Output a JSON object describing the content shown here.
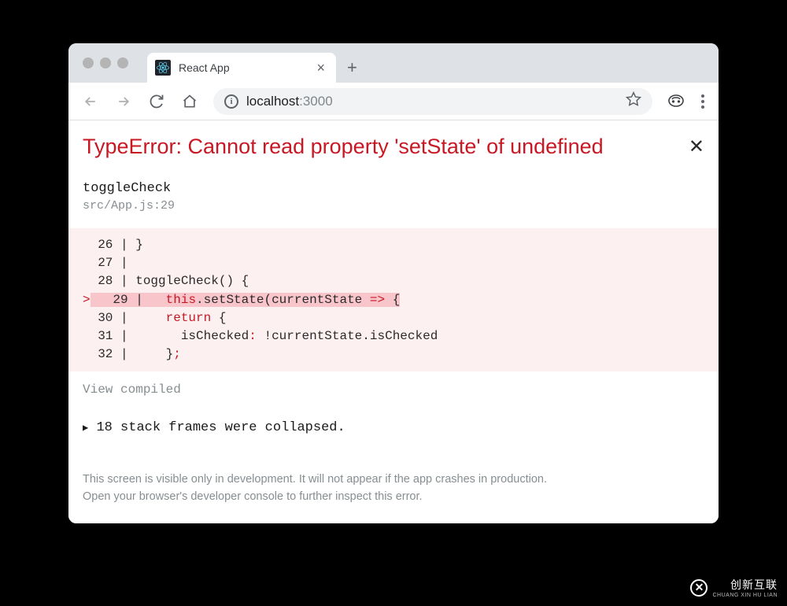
{
  "browser": {
    "tab": {
      "title": "React App"
    },
    "url": {
      "host": "localhost",
      "port": ":3000"
    }
  },
  "error": {
    "title": "TypeError: Cannot read property 'setState' of undefined",
    "function": "toggleCheck",
    "source": "src/App.js:29",
    "viewCompiled": "View compiled",
    "collapsed": "18 stack frames were collapsed.",
    "footer1": "This screen is visible only in development. It will not appear if the app crashes in production.",
    "footer2": "Open your browser's developer console to further inspect this error."
  },
  "code": {
    "l26": {
      "num": "  26",
      "text": "}"
    },
    "l27": {
      "num": "  27",
      "text": ""
    },
    "l28": {
      "num": "  28",
      "text": "toggleCheck() {"
    },
    "l29": {
      "num": "  29",
      "ptr": ">",
      "kw1": "this",
      "mid1": ".setState(currentState ",
      "arrow": "=>",
      "end": " {"
    },
    "l30": {
      "num": "  30",
      "kw": "return",
      "end": " {"
    },
    "l31": {
      "num": "  31",
      "text": "isChecked",
      "colon": ":",
      "bang": " !",
      "rest": "currentState.isChecked"
    },
    "l32": {
      "num": "  32",
      "brace": "}",
      "semi": ";"
    }
  },
  "watermark": {
    "main": "创新互联",
    "sub": "CHUANG XIN HU LIAN"
  }
}
